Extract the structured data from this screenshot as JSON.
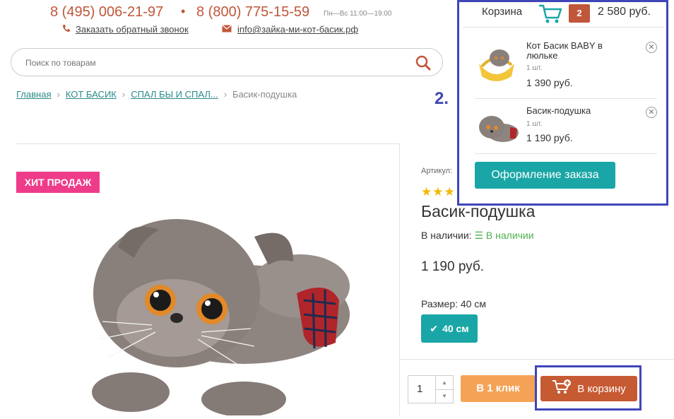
{
  "header": {
    "phone1": "8 (495) 006-21-97",
    "bullet": "•",
    "phone2": "8 (800) 775-15-59",
    "hours": "Пн—Вс 11:00—19:00",
    "callback_label": "Заказать обратный звонок",
    "email": "info@зайка-ми-кот-басик.рф"
  },
  "search": {
    "placeholder": "Поиск по товарам"
  },
  "breadcrumbs": [
    "Главная",
    "КОТ БАСИК",
    "СПАЛ БЫ И СПАЛ...",
    "Басик-подушка"
  ],
  "product": {
    "badge": "ХИТ ПРОДАЖ",
    "article_label": "Артикул:",
    "stars": "★★★",
    "title": "Басик-подушка",
    "stock_label": "В наличии:",
    "stock_value": "В наличии",
    "price": "1 190 руб.",
    "size_label": "Размер: 40 см",
    "size_option": "40 см",
    "quantity": "1",
    "one_click_label": "В 1 клик",
    "add_to_cart_label": "В корзину"
  },
  "annotation": {
    "label": "2."
  },
  "cart": {
    "title": "Корзина",
    "count": "2",
    "total": "2 580 руб.",
    "items": [
      {
        "name": "Кот Басик BABY в люльке",
        "qty": "1 шт.",
        "price": "1 390 руб."
      },
      {
        "name": "Басик-подушка",
        "qty": "1 шт.",
        "price": "1 190 руб."
      }
    ],
    "checkout_label": "Оформление заказа"
  },
  "colors": {
    "accent_teal": "#1aa6a6",
    "brand_red": "#c0563a",
    "hit_pink": "#ee3c8a",
    "one_click_orange": "#f4a356",
    "annotation_blue": "#3f46b8"
  }
}
